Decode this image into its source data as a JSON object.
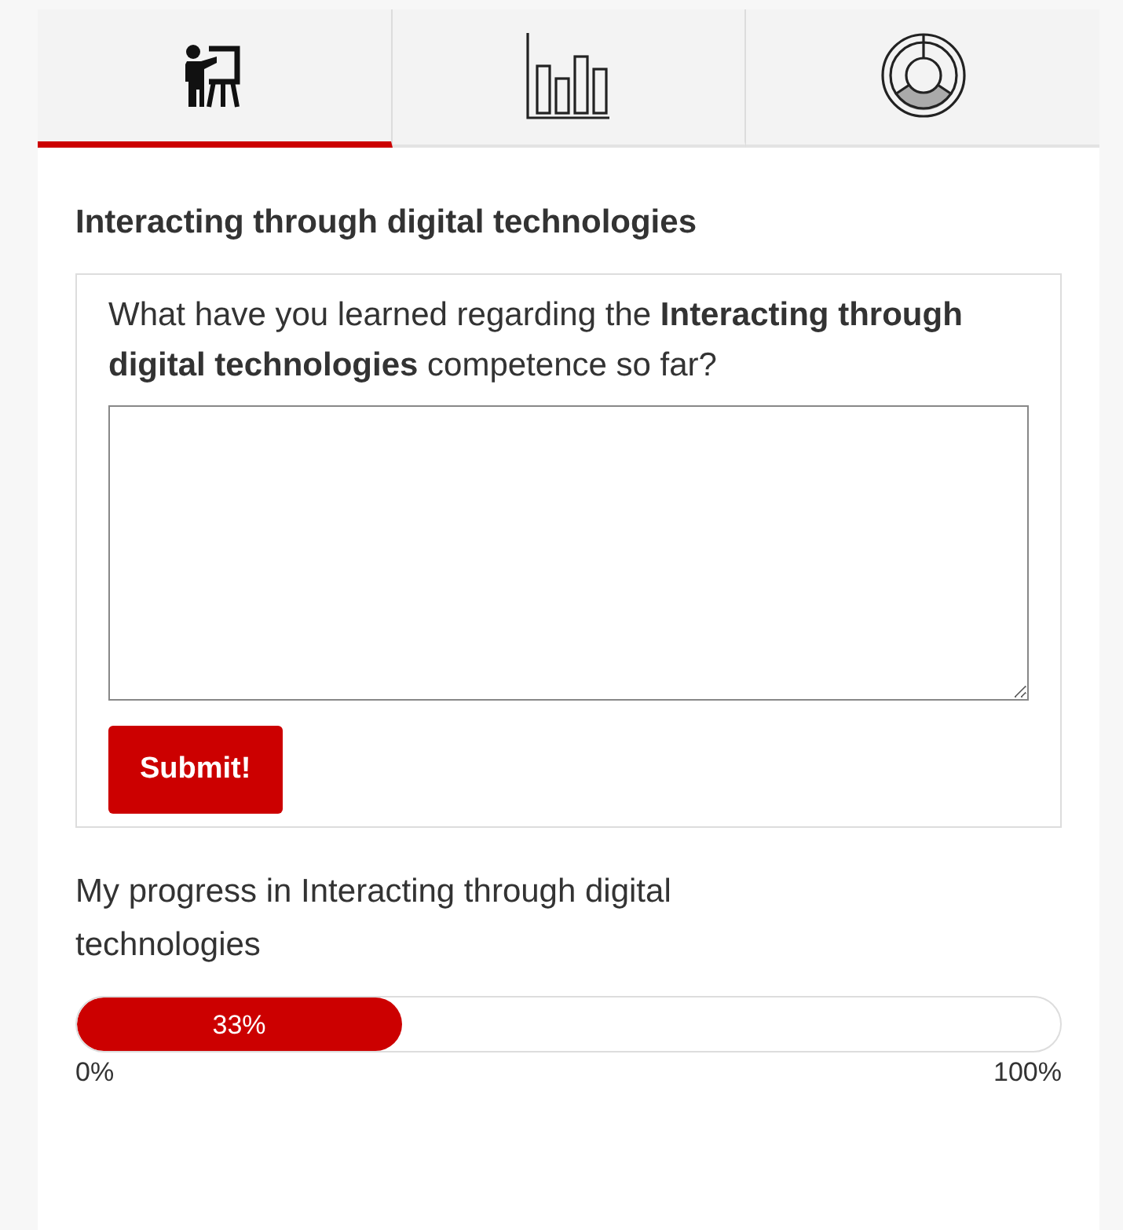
{
  "tabs": [
    {
      "kind": "presenter",
      "selected": true
    },
    {
      "kind": "bar-chart",
      "selected": false
    },
    {
      "kind": "donut",
      "selected": false
    }
  ],
  "heading": "Interacting through digital technologies",
  "question": {
    "prompt": "What have you learned regarding the **Interacting through digital technologies** competence so far?",
    "button": "Submit!"
  },
  "progress": {
    "label": "My progress in Interacting through digital technologies",
    "level": 0.33,
    "reading": "33%",
    "min_label": "0%",
    "max_label": "100%"
  }
}
